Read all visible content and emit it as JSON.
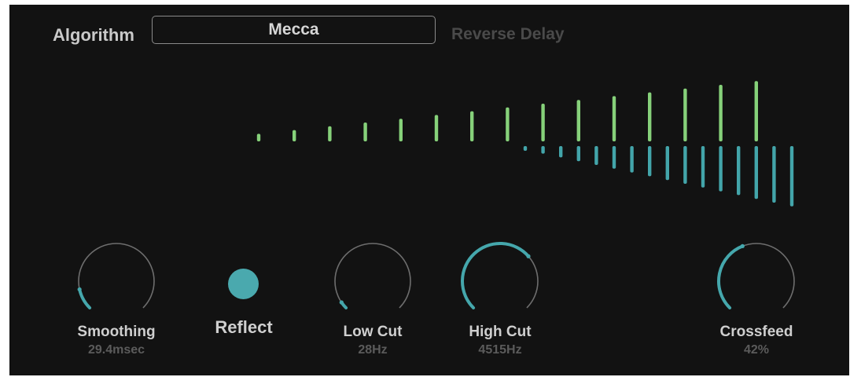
{
  "algorithm": {
    "label": "Algorithm",
    "selected": "Mecca",
    "subtitle": "Reverse Delay"
  },
  "visualizer": {
    "green_color": "#86d17a",
    "teal_color": "#43a5aa",
    "green_levels": [
      0.12,
      0.18,
      0.24,
      0.3,
      0.36,
      0.42,
      0.48,
      0.54,
      0.6,
      0.66,
      0.72,
      0.78,
      0.84,
      0.9,
      0.96
    ],
    "teal_levels": [
      0.06,
      0.12,
      0.18,
      0.24,
      0.3,
      0.36,
      0.42,
      0.48,
      0.54,
      0.6,
      0.66,
      0.72,
      0.78,
      0.84,
      0.9,
      0.96
    ]
  },
  "knobs": [
    {
      "id": "smoothing",
      "label": "Smoothing",
      "value": "29.4msec",
      "level": 0.12
    },
    {
      "id": "low-cut",
      "label": "Low Cut",
      "value": "28Hz",
      "level": 0.04
    },
    {
      "id": "high-cut",
      "label": "High Cut",
      "value": "4515Hz",
      "level": 0.68
    },
    {
      "id": "crossfeed",
      "label": "Crossfeed",
      "value": "42%",
      "level": 0.42
    }
  ],
  "reflect": {
    "label": "Reflect",
    "color": "#4aa9ae"
  },
  "colors": {
    "background": "#121212",
    "knob_track": "#6e6e6e",
    "knob_accent": "#45a7ac"
  }
}
